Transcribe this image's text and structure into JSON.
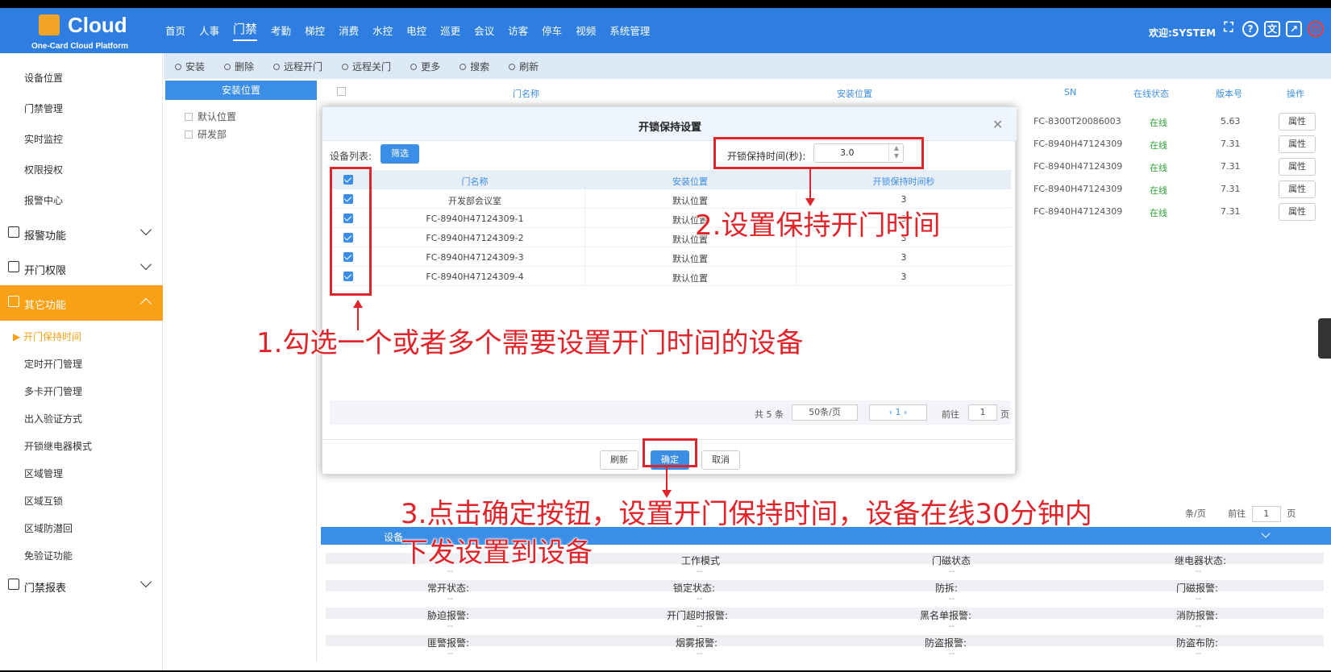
{
  "header": {
    "brand": "Cloud",
    "subtitle": "One-Card Cloud Platform",
    "nav": [
      "首页",
      "人事",
      "门禁",
      "考勤",
      "梯控",
      "消费",
      "水控",
      "电控",
      "巡更",
      "会议",
      "访客",
      "停车",
      "视频",
      "系统管理"
    ],
    "active_nav": "门禁",
    "welcome": "欢迎:SYSTEM",
    "icons": [
      "fullscreen-icon",
      "help-icon",
      "translate-icon",
      "external-link-icon",
      "power-icon"
    ]
  },
  "sidebar": {
    "top_items": [
      "设备位置",
      "门禁管理",
      "实时监控",
      "权限授权",
      "报警中心"
    ],
    "groups": [
      {
        "label": "报警功能",
        "icon": "alarm-icon"
      },
      {
        "label": "开门权限",
        "icon": "door-icon"
      },
      {
        "label": "其它功能",
        "icon": "grid-icon"
      }
    ],
    "sub_items": [
      "开门保持时间",
      "定时开门管理",
      "多卡开门管理",
      "出入验证方式",
      "开锁继电器模式",
      "区域管理",
      "区域互锁",
      "区域防潜回",
      "免验证功能"
    ],
    "current": "开门保持时间",
    "last_group": {
      "label": "门禁报表",
      "icon": "chart-icon"
    }
  },
  "toolbar": {
    "buttons": [
      "安装",
      "删除",
      "远程开门",
      "远程关门",
      "更多",
      "搜索",
      "刷新"
    ]
  },
  "tree": {
    "title": "安装位置",
    "nodes": [
      "默认位置",
      "研发部"
    ]
  },
  "main_table": {
    "columns": [
      "门名称",
      "安装位置",
      "SN",
      "在线状态",
      "版本号",
      "操作"
    ],
    "rows": [
      {
        "sn": "FC-8300T20086003",
        "status": "在线",
        "version": "5.63",
        "action": "属性"
      },
      {
        "sn": "FC-8940H47124309",
        "status": "在线",
        "version": "7.31",
        "action": "属性"
      },
      {
        "sn": "FC-8940H47124309",
        "status": "在线",
        "version": "7.31",
        "action": "属性"
      },
      {
        "sn": "FC-8940H47124309",
        "status": "在线",
        "version": "7.31",
        "action": "属性"
      },
      {
        "sn": "FC-8940H47124309",
        "status": "在线",
        "version": "7.31",
        "action": "属性"
      }
    ],
    "pager_size": "条/页",
    "pager_goto": "前往",
    "pager_page": "1",
    "pager_unit": "页"
  },
  "info_panel": {
    "title": "设备",
    "rows": [
      [
        "工作模式",
        "门磁状态",
        "继电器状态:"
      ],
      [
        "常开状态:",
        "锁定状态:",
        "防拆:",
        "门磁报警:"
      ],
      [
        "胁迫报警:",
        "开门超时报警:",
        "黑名单报警:",
        "消防报警:"
      ],
      [
        "匪警报警:",
        "烟雾报警:",
        "防盗报警:",
        "防盗布防:"
      ]
    ],
    "empty": "--"
  },
  "modal": {
    "title": "开锁保持设置",
    "device_list_label": "设备列表:",
    "filter_button": "筛选",
    "hold_label": "开锁保持时间(秒):",
    "hold_value": "3.0",
    "columns": [
      "门名称",
      "安装位置",
      "开锁保持时间秒"
    ],
    "rows": [
      {
        "name": "开发部会议室",
        "location": "默认位置",
        "hold": "3"
      },
      {
        "name": "FC-8940H47124309-1",
        "location": "默认位置",
        "hold": "3"
      },
      {
        "name": "FC-8940H47124309-2",
        "location": "默认位置",
        "hold": "3"
      },
      {
        "name": "FC-8940H47124309-3",
        "location": "默认位置",
        "hold": "3"
      },
      {
        "name": "FC-8940H47124309-4",
        "location": "默认位置",
        "hold": "3"
      }
    ],
    "pager": {
      "total": "共 5 条",
      "size": "50条/页",
      "page": "1",
      "goto": "前往",
      "goto_value": "1",
      "unit": "页"
    },
    "buttons": {
      "refresh": "刷新",
      "confirm": "确定",
      "cancel": "取消"
    }
  },
  "annotations": {
    "step1": "1.勾选一个或者多个需要设置开门时间的设备",
    "step2": "2.设置保持开门时间",
    "step3_line1": "3.点击确定按钮，设置开门保持时间，设备在线30分钟内",
    "step3_line2": "下发设置到设备",
    "color": "#e0242a"
  },
  "colors": {
    "primary": "#2d7ee0",
    "accent": "#f8a116",
    "online": "#2aa330"
  }
}
